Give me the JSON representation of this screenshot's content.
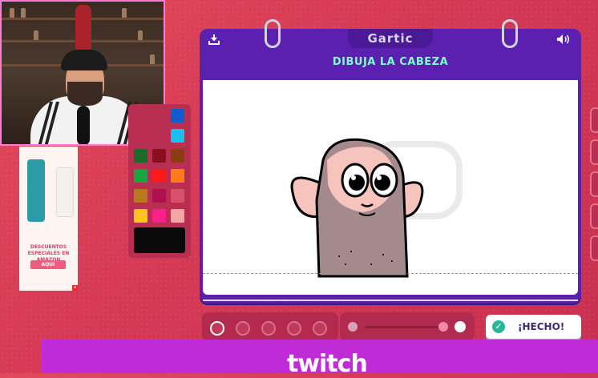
{
  "game": {
    "logo": "Gartic",
    "prompt_title": "DIBUJA LA CABEZA",
    "done_button": "¡HECHO!",
    "download_icon": "download-icon",
    "sound_icon": "speaker-icon"
  },
  "palette": {
    "colors": [
      "#0f5ccf",
      "#18c0f0",
      "#1b6b2a",
      "#8a0f1c",
      "#8a3d12",
      "#18a640",
      "#ff1a1a",
      "#ff7a1a",
      "#b8781e",
      "#b01050",
      "#d8506a",
      "#ffc21e",
      "#ff1f8a",
      "#f5a5a5"
    ],
    "selected": "#0a0a0a"
  },
  "ad": {
    "headline": "DESCUENTOS ESPECIALES EN AMAZON",
    "cta": "AQUÍ"
  },
  "stream": {
    "banner_text": "twitch"
  },
  "colors": {
    "panel": "#5b20b0",
    "title": "#7fffd0",
    "banner": "#bf2bd6"
  }
}
